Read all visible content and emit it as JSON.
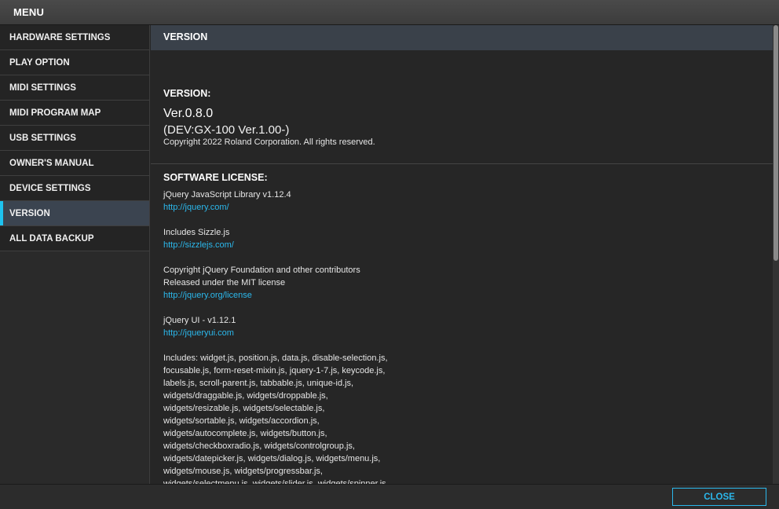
{
  "window": {
    "title": "MENU"
  },
  "sidebar": {
    "items": [
      {
        "label": "HARDWARE SETTINGS",
        "active": false
      },
      {
        "label": "PLAY OPTION",
        "active": false
      },
      {
        "label": "MIDI SETTINGS",
        "active": false
      },
      {
        "label": "MIDI PROGRAM MAP",
        "active": false
      },
      {
        "label": "USB SETTINGS",
        "active": false
      },
      {
        "label": "OWNER'S MANUAL",
        "active": false
      },
      {
        "label": "DEVICE SETTINGS",
        "active": false
      },
      {
        "label": "VERSION",
        "active": true
      },
      {
        "label": "ALL DATA BACKUP",
        "active": false
      }
    ]
  },
  "content": {
    "header": "VERSION",
    "version_label": "VERSION:",
    "version_value": "Ver.0.8.0",
    "device_version": "(DEV:GX-100 Ver.1.00-)",
    "copyright": "Copyright 2022 Roland Corporation. All rights reserved.",
    "license_title": "SOFTWARE LICENSE:",
    "licenses": [
      {
        "lines": [
          "jQuery JavaScript Library v1.12.4"
        ],
        "link": "http://jquery.com/"
      },
      {
        "lines": [
          "Includes Sizzle.js"
        ],
        "link": "http://sizzlejs.com/"
      },
      {
        "lines": [
          "Copyright jQuery Foundation and other contributors",
          "Released under the MIT license"
        ],
        "link": "http://jquery.org/license"
      },
      {
        "lines": [
          "jQuery UI - v1.12.1"
        ],
        "link": "http://jqueryui.com"
      },
      {
        "lines": [
          "Includes: widget.js, position.js, data.js, disable-selection.js,",
          "focusable.js, form-reset-mixin.js, jquery-1-7.js, keycode.js,",
          "labels.js, scroll-parent.js, tabbable.js, unique-id.js,",
          "widgets/draggable.js, widgets/droppable.js,",
          "widgets/resizable.js, widgets/selectable.js,",
          "widgets/sortable.js, widgets/accordion.js,",
          "widgets/autocomplete.js, widgets/button.js,",
          "widgets/checkboxradio.js, widgets/controlgroup.js,",
          "widgets/datepicker.js, widgets/dialog.js, widgets/menu.js,",
          "widgets/mouse.js, widgets/progressbar.js,",
          "widgets/selectmenu.js, widgets/slider.js, widgets/spinner.js"
        ],
        "link": ""
      }
    ]
  },
  "footer": {
    "close_label": "CLOSE"
  },
  "colors": {
    "accent": "#2bb8ec",
    "active_bar": "#1ec3f0",
    "active_bg": "#3b4450"
  }
}
